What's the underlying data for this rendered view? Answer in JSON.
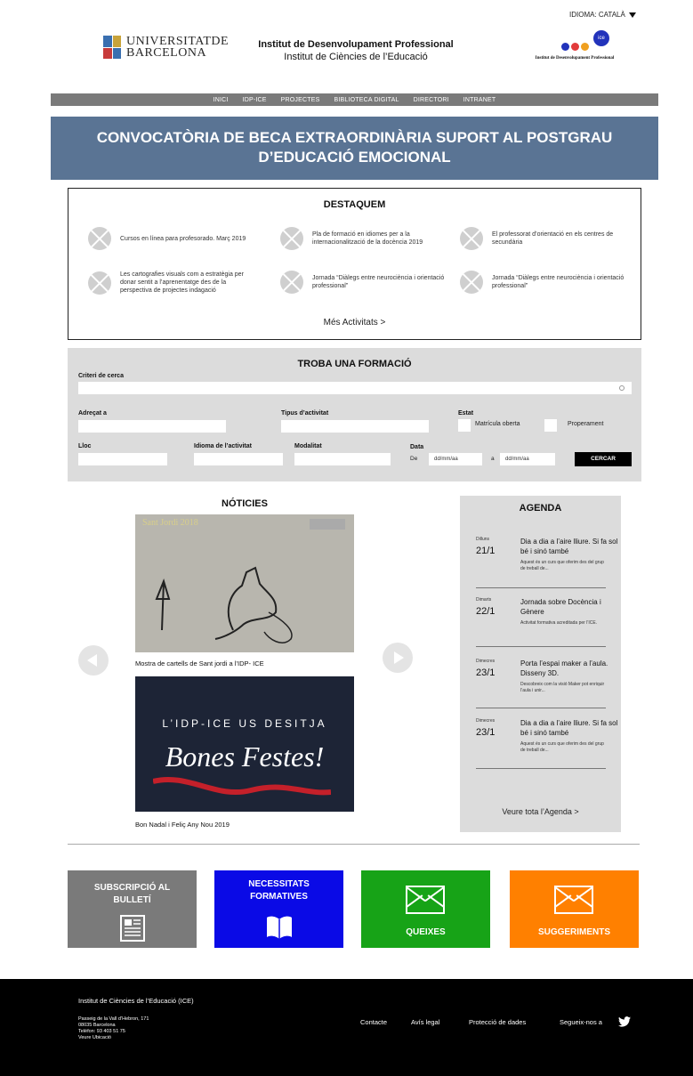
{
  "header": {
    "language": "IDIOMA: CATALÀ",
    "ub_logo_line1": "UNIVERSITATDE",
    "ub_logo_line2": "BARCELONA",
    "title_line1": "Institut de Desenvolupament Professional",
    "title_line2": "Institut de Ciències de l’Educació",
    "idp_circle": "ice",
    "idp_sub": "Institut de Desenvolupament Professional"
  },
  "nav": [
    "INICI",
    "IDP-ICE",
    "PROJECTES",
    "BIBLIOTECA DIGITAL",
    "DIRECTORI",
    "INTRANET"
  ],
  "hero": {
    "line1": "CONVOCATÒRIA DE BECA EXTRAORDINÀRIA SUPORT AL POSTGRAU",
    "line2": "D’EDUCACIÓ EMOCIONAL"
  },
  "destaquem": {
    "title": "DESTAQUEM",
    "items": [
      "Cursos en línea para profesorado. Març 2019",
      "Pla de formació en idiomes per a la internacionalització de la docència 2019",
      "El professorat d’orientació en els centres de secundària",
      "Les cartografies visuals com a estratègia per donar sentit a l’aprenentatge des de la perspectiva de projectes indagació",
      "Jornada “Diàlegs entre neurociència i orientació professional”",
      "Jornada “Diàlegs entre neurociència i orientació professional”"
    ],
    "more": "Més Activitats >"
  },
  "search": {
    "title": "TROBA UNA FORMACIÓ",
    "criteri_label": "Criteri de cerca",
    "adrecat_label": "Adreçat a",
    "tipus_label": "Tipus d’activitat",
    "estat_label": "Estat",
    "estat_opt1": "Matrícula oberta",
    "estat_opt2": "Properament",
    "lloc_label": "Lloc",
    "idioma_label": "Idioma de l’activitat",
    "modalitat_label": "Modalitat",
    "data_label": "Data",
    "de_label": "De",
    "a_label": "a",
    "date_placeholder_from": "dd/mm/aa",
    "date_placeholder_to": "dd/mm/aa",
    "button": "CERCAR"
  },
  "news": {
    "title": "NÓTICIES",
    "img1_title": "Sant Jordi 2018",
    "item1": "Mostra de cartells de Sant jordi a l’IDP- ICE",
    "img2_line1": "L’IDP-ICE US DESITJA",
    "img2_line2": "Bones Festes!",
    "item2": "Bon Nadal i Feliç Any Nou 2019"
  },
  "agenda": {
    "title": "AGENDA",
    "items": [
      {
        "day": "Dilluns",
        "date": "21/1",
        "title": "Dia a dia a l’aire lliure. Si fa sol bé i sinó també",
        "desc": "Aquest és un curs que oferim des del grup de treball de..."
      },
      {
        "day": "Dimarts",
        "date": "22/1",
        "title": "Jornada sobre Docència i Gènere",
        "desc": "Activitat formativa acreditada per l’ICE."
      },
      {
        "day": "Dimecres",
        "date": "23/1",
        "title": "Porta l’espai maker a l’aula. Disseny 3D.",
        "desc": "Descobreix com la visió Maker pot enriquir l’aula i unir..."
      },
      {
        "day": "Dimecres",
        "date": "23/1",
        "title": "Dia a dia a l’aire lliure. Si fa sol bé i sinó també",
        "desc": "Aquest és un curs que oferim des del grup de treball de..."
      }
    ],
    "all": "Veure tota l’Agenda >"
  },
  "tiles": {
    "t1_line1": "SUBSCRIPCIÓ AL",
    "t1_line2": "BULLETÍ",
    "t2_line1": "NECESSITATS",
    "t2_line2": "FORMATIVES",
    "t3": "QUEIXES",
    "t4": "SUGGERIMENTS",
    "colors": {
      "t1": "#7a7a7a",
      "t2": "#0a0ae6",
      "t3": "#17a317",
      "t4": "#ff8000"
    }
  },
  "footer": {
    "name": "Institut de Ciències de l’Educació (ICE)",
    "addr1": "Passeig de la Vall d’Hebron, 171",
    "addr2": "08035 Barcelona",
    "addr3": "Telèfon: 93 403 51 75",
    "addr4": "Veure Ubicació",
    "link1": "Contacte",
    "link2": "Avís legal",
    "link3": "Protecció de dades",
    "link4": "Segueix-nos a"
  }
}
